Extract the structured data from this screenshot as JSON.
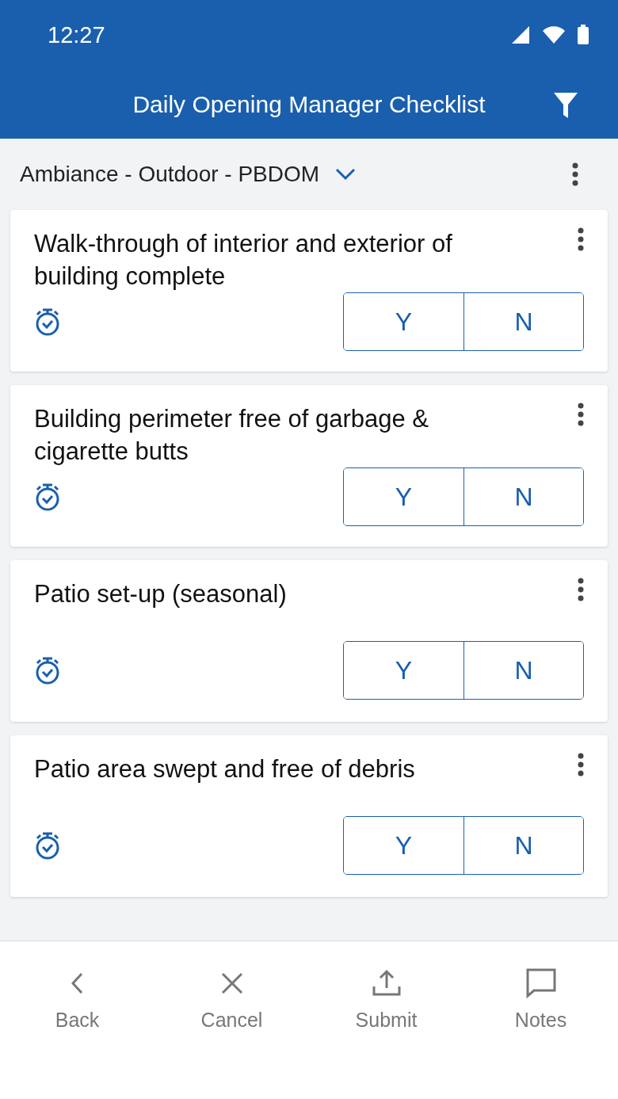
{
  "status_bar": {
    "time": "12:27"
  },
  "app_bar": {
    "title": "Daily Opening Manager Checklist"
  },
  "section": {
    "title": "Ambiance - Outdoor - PBDOM"
  },
  "items": [
    {
      "text": "Walk-through of interior and exterior of building complete",
      "answers": [
        "Y",
        "N"
      ]
    },
    {
      "text": "Building perimeter free of garbage & cigarette butts",
      "answers": [
        "Y",
        "N"
      ]
    },
    {
      "text": "Patio set-up (seasonal)",
      "answers": [
        "Y",
        "N"
      ]
    },
    {
      "text": "Patio area swept and free of debris",
      "answers": [
        "Y",
        "N"
      ]
    }
  ],
  "nav": [
    {
      "kind": "back",
      "label": "Back"
    },
    {
      "kind": "cancel",
      "label": "Cancel"
    },
    {
      "kind": "submit",
      "label": "Submit"
    },
    {
      "kind": "notes",
      "label": "Notes"
    }
  ]
}
